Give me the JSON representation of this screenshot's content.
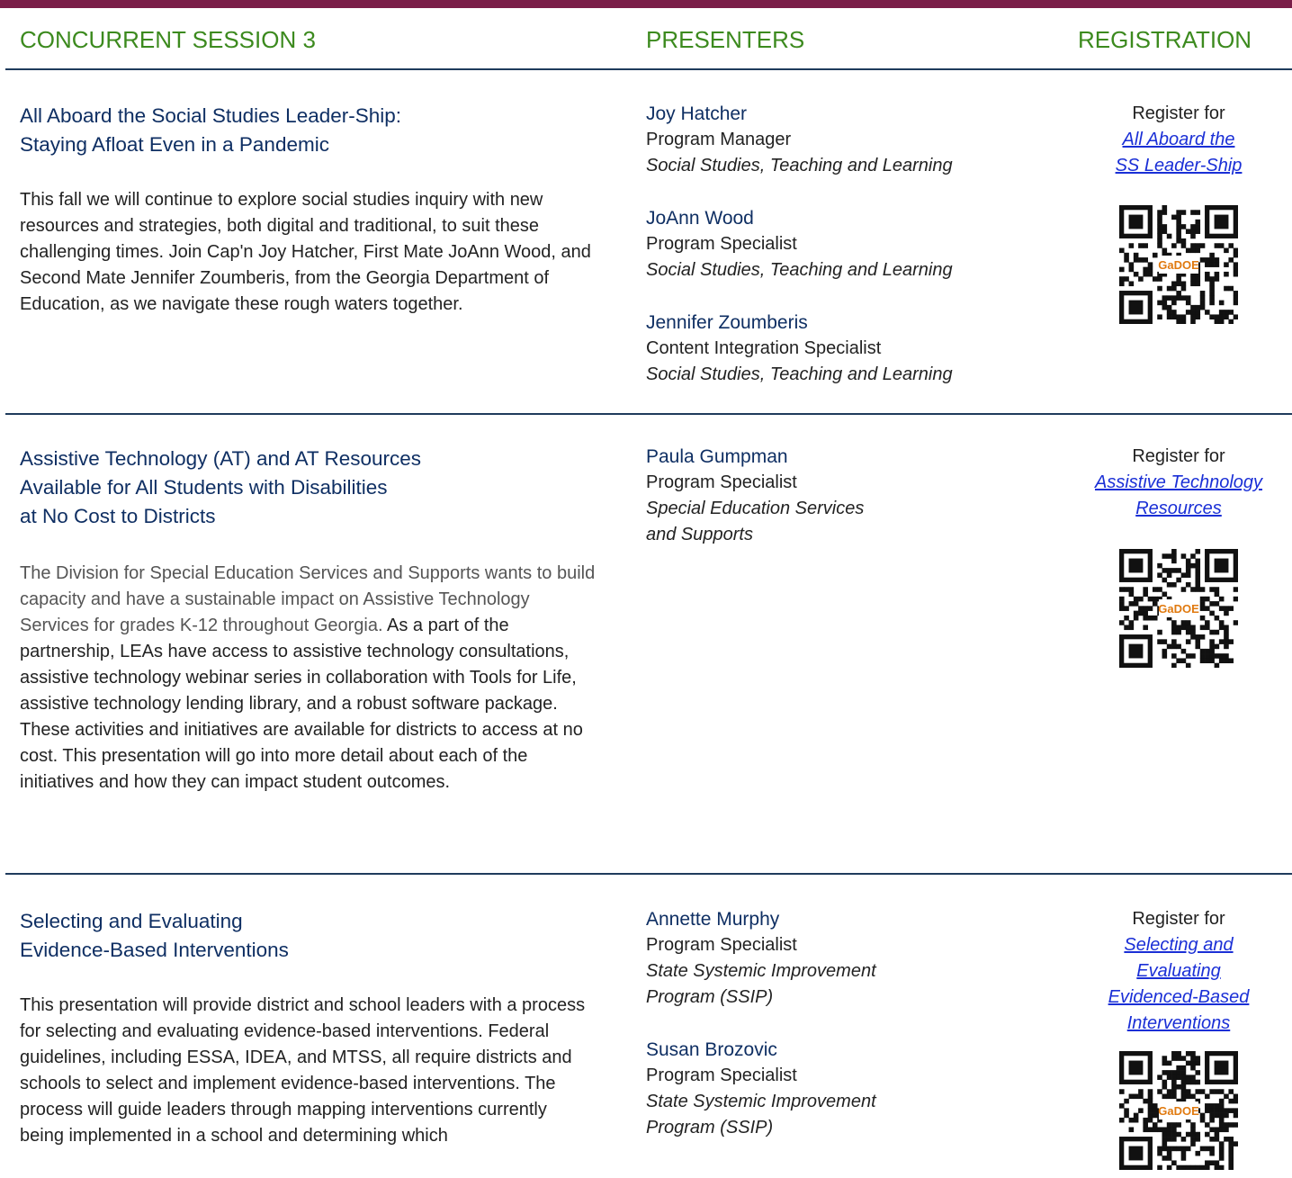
{
  "headers": {
    "session": "CONCURRENT SESSION 3",
    "presenters": "PRESENTERS",
    "registration": "REGISTRATION"
  },
  "colors": {
    "top_bar": "#7a1e48",
    "header_green": "#3c8a1e",
    "title_navy": "#0f2f63",
    "link_blue": "#1a2fd6",
    "rule": "#1f3b5c"
  },
  "sessions": [
    {
      "title_lines": [
        "All Aboard the Social Studies Leader-Ship:",
        "Staying Afloat Even in a Pandemic"
      ],
      "description": "This fall we will continue to explore social studies inquiry with new resources and strategies, both digital and traditional, to suit these challenging times. Join Cap'n Joy Hatcher, First Mate JoAnn Wood, and Second Mate Jennifer Zoumberis, from the Georgia Department of Education, as we navigate these rough waters together.",
      "presenters": [
        {
          "name": "Joy Hatcher",
          "role": "Program Manager",
          "dept_lines": [
            "Social Studies, Teaching and Learning"
          ]
        },
        {
          "name": "JoAnn Wood",
          "role": "Program Specialist",
          "dept_lines": [
            "Social Studies, Teaching and Learning"
          ]
        },
        {
          "name": "Jennifer Zoumberis",
          "role": "Content Integration Specialist",
          "dept_lines": [
            "Social Studies, Teaching and Learning"
          ]
        }
      ],
      "register_label": "Register for",
      "register_link_lines": [
        "All Aboard the",
        "SS Leader-Ship"
      ],
      "qr_icon": "qr-code-icon"
    },
    {
      "title_lines": [
        "Assistive Technology (AT) and AT Resources",
        "Available for All Students with Disabilities",
        "at No Cost to Districts"
      ],
      "description_muted": "The Division for Special Education Services and Supports wants to build capacity and have a sustainable impact on Assistive Technology Services for grades K-12 throughout Georgia.",
      "description": " As a part of the partnership, LEAs have access to assistive technology consultations, assistive technology webinar series in collaboration with Tools for Life, assistive technology lending library, and a robust software package. These activities and initiatives are available for districts to access at no cost. This presentation will go into more detail about each of the initiatives and how they can impact student outcomes.",
      "presenters": [
        {
          "name": "Paula Gumpman",
          "role": "Program Specialist",
          "dept_lines": [
            "Special Education Services",
            "and Supports"
          ]
        }
      ],
      "register_label": "Register for",
      "register_link_lines": [
        "Assistive Technology",
        "Resources"
      ],
      "qr_icon": "qr-code-icon"
    },
    {
      "title_lines": [
        "Selecting and Evaluating",
        "Evidence-Based Interventions"
      ],
      "description": "This presentation will provide district and school leaders with a process for selecting and evaluating evidence-based interventions. Federal guidelines, including ESSA, IDEA, and MTSS, all require districts and schools to select and implement evidence-based interventions. The process will guide leaders through mapping interventions currently being implemented in a school and determining which",
      "presenters": [
        {
          "name": "Annette Murphy",
          "role": "Program Specialist",
          "dept_lines": [
            "State Systemic Improvement",
            "Program (SSIP)"
          ]
        },
        {
          "name": "Susan Brozovic",
          "role": "Program Specialist",
          "dept_lines": [
            "State Systemic Improvement",
            "Program (SSIP)"
          ]
        }
      ],
      "register_label": "Register for",
      "register_link_lines": [
        "Selecting and",
        "Evaluating",
        "Evidenced-Based",
        "Interventions"
      ],
      "qr_icon": "qr-code-icon",
      "qr_logo_text": "GaDOE"
    }
  ]
}
